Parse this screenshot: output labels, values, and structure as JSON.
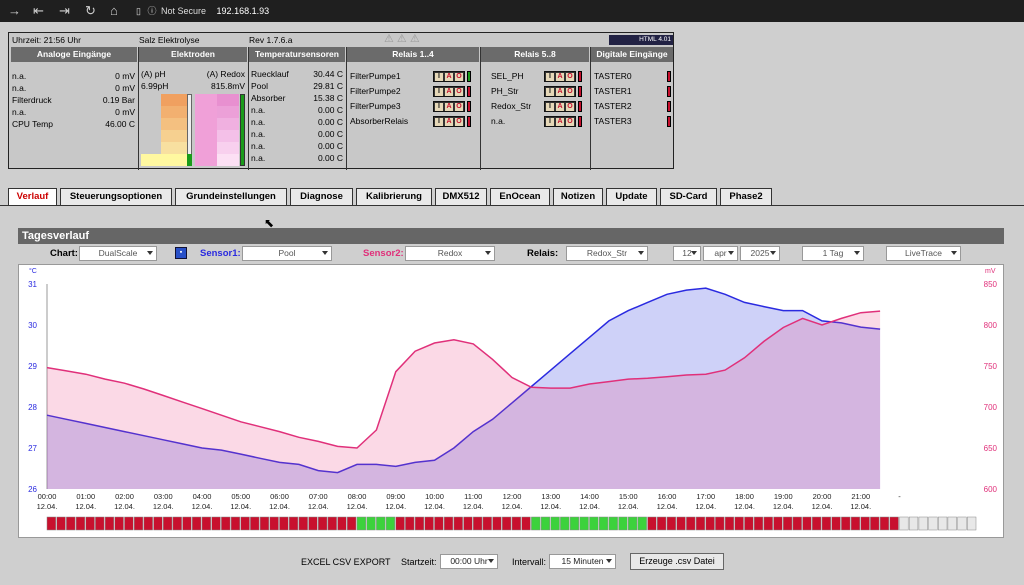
{
  "browser": {
    "url": "192.168.1.93",
    "security": "Not Secure"
  },
  "status": {
    "time": "Uhrzeit: 21:56 Uhr",
    "title": "Salz Elektrolyse",
    "rev": "Rev 1.7.6.a",
    "logo": "HTML 4.01",
    "headers": [
      "Analoge Eingänge",
      "Elektroden",
      "Temperatursensoren",
      "Relais 1..4",
      "Relais 5..8",
      "Digitale Eingänge"
    ],
    "analog": [
      {
        "name": "n.a.",
        "value": "0 mV"
      },
      {
        "name": "n.a.",
        "value": "0 mV"
      },
      {
        "name": "Filterdruck",
        "value": "0.19 Bar"
      },
      {
        "name": "n.a.",
        "value": "0 mV"
      },
      {
        "name": "CPU Temp",
        "value": "46.00 C"
      }
    ],
    "electrodes": {
      "ph_label": "(A) pH",
      "ph_value": "6.99pH",
      "redox_label": "(A) Redox",
      "redox_value": "815.8mV"
    },
    "temps": [
      {
        "name": "Ruecklauf",
        "value": "30.44 C"
      },
      {
        "name": "Pool",
        "value": "29.81 C"
      },
      {
        "name": "Absorber",
        "value": "15.38 C"
      },
      {
        "name": "n.a.",
        "value": "0.00 C"
      },
      {
        "name": "n.a.",
        "value": "0.00 C"
      },
      {
        "name": "n.a.",
        "value": "0.00 C"
      },
      {
        "name": "n.a.",
        "value": "0.00 C"
      },
      {
        "name": "n.a.",
        "value": "0.00 C"
      }
    ],
    "relais1": [
      {
        "name": "FilterPumpe1",
        "state": "on"
      },
      {
        "name": "FilterPumpe2",
        "state": "off"
      },
      {
        "name": "FilterPumpe3",
        "state": "off"
      },
      {
        "name": "AbsorberRelais",
        "state": "off"
      }
    ],
    "relais2": [
      {
        "name": "SEL_PH",
        "state": "off"
      },
      {
        "name": "PH_Str",
        "state": "off"
      },
      {
        "name": "Redox_Str",
        "state": "off"
      },
      {
        "name": "n.a.",
        "state": "off"
      }
    ],
    "iao": [
      "I",
      "A",
      "O"
    ],
    "digital": [
      "TASTER0",
      "TASTER1",
      "TASTER2",
      "TASTER3"
    ],
    "colors": {
      "on": "#1a9b1a",
      "off": "#c8102e",
      "header": "#6b6b6b"
    }
  },
  "tabs": [
    "Verlauf",
    "Steuerungsoptionen",
    "Grundeinstellungen",
    "Diagnose",
    "Kalibrierung",
    "DMX512",
    "EnOcean",
    "Notizen",
    "Update",
    "SD-Card",
    "Phase2"
  ],
  "panel": {
    "title": "Tagesverlauf"
  },
  "controls": {
    "chart_label": "Chart:",
    "chart_value": "DualScale",
    "sensor1_label": "Sensor1:",
    "sensor1_value": "Pool",
    "sensor2_label": "Sensor2:",
    "sensor2_value": "Redox",
    "relais_label": "Relais:",
    "relais_value": "Redox_Str",
    "day": "12",
    "month": "apr",
    "year": "2025",
    "range": "1 Tag",
    "mode": "LiveTrace"
  },
  "export": {
    "label": "EXCEL CSV EXPORT",
    "start_label": "Startzeit:",
    "start_value": "00:00 Uhr",
    "interval_label": "Intervall:",
    "interval_value": "15 Minuten",
    "button": "Erzeuge .csv Datei"
  },
  "chart_data": {
    "type": "line",
    "x": [
      "00:00",
      "00:30",
      "01:00",
      "01:30",
      "02:00",
      "02:30",
      "03:00",
      "03:30",
      "04:00",
      "04:30",
      "05:00",
      "05:30",
      "06:00",
      "06:30",
      "07:00",
      "07:30",
      "08:00",
      "08:30",
      "09:00",
      "09:30",
      "10:00",
      "10:30",
      "11:00",
      "11:30",
      "12:00",
      "12:30",
      "13:00",
      "13:30",
      "14:00",
      "14:30",
      "15:00",
      "15:30",
      "16:00",
      "16:30",
      "17:00",
      "17:30",
      "18:00",
      "18:30",
      "19:00",
      "19:30",
      "20:00",
      "20:30",
      "21:00",
      "21:30"
    ],
    "x_labels": [
      "00:00",
      "01:00",
      "02:00",
      "03:00",
      "04:00",
      "05:00",
      "06:00",
      "07:00",
      "08:00",
      "09:00",
      "10:00",
      "11:00",
      "12:00",
      "13:00",
      "14:00",
      "15:00",
      "16:00",
      "17:00",
      "18:00",
      "19:00",
      "20:00",
      "21:00",
      "-"
    ],
    "x_date": "12.04.",
    "y_left": {
      "unit": "°C",
      "range": [
        26,
        31
      ],
      "ticks": [
        26,
        27,
        28,
        29,
        30,
        31
      ]
    },
    "y_right": {
      "unit": "mV",
      "range": [
        600,
        850
      ],
      "ticks": [
        600,
        650,
        700,
        750,
        800,
        850
      ]
    },
    "series": [
      {
        "name": "Pool",
        "axis": "left",
        "color": "#2a2ae0",
        "values": [
          27.8,
          27.7,
          27.6,
          27.5,
          27.4,
          27.3,
          27.2,
          27.1,
          27.0,
          26.95,
          26.85,
          26.75,
          26.65,
          26.6,
          26.45,
          26.4,
          26.6,
          26.6,
          26.55,
          26.65,
          26.7,
          27.0,
          27.4,
          27.7,
          28.1,
          28.5,
          28.9,
          29.3,
          29.7,
          30.1,
          30.35,
          30.55,
          30.75,
          30.85,
          30.9,
          30.75,
          30.55,
          30.45,
          30.35,
          30.35,
          30.1,
          30.05,
          29.95,
          29.9
        ]
      },
      {
        "name": "Redox",
        "axis": "right",
        "color": "#e0307a",
        "values": [
          748,
          744,
          740,
          734,
          729,
          722,
          714,
          706,
          698,
          690,
          682,
          676,
          670,
          663,
          658,
          652,
          650,
          672,
          743,
          768,
          778,
          782,
          777,
          758,
          736,
          724,
          723,
          723,
          728,
          731,
          734,
          735,
          737,
          739,
          740,
          745,
          760,
          780,
          797,
          808,
          800,
          808,
          815,
          817
        ]
      }
    ],
    "relais_strip": {
      "name": "Redox_Str",
      "segments": [
        {
          "state": "off",
          "from": "00:00",
          "to": "08:00"
        },
        {
          "state": "on",
          "from": "08:00",
          "to": "09:00"
        },
        {
          "state": "off",
          "from": "09:00",
          "to": "12:30"
        },
        {
          "state": "on",
          "from": "12:30",
          "to": "15:30"
        },
        {
          "state": "off",
          "from": "15:30",
          "to": "22:00"
        },
        {
          "state": "none",
          "from": "22:00",
          "to": "24:00"
        }
      ]
    }
  }
}
